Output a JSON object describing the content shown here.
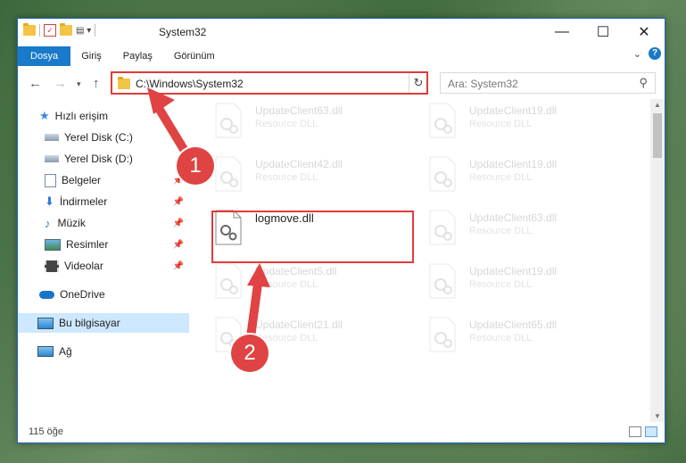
{
  "window": {
    "title": "System32",
    "controls": {
      "minimize": "—",
      "maximize": "☐",
      "close": "✕"
    }
  },
  "ribbon": {
    "tabs": [
      "Dosya",
      "Giriş",
      "Paylaş",
      "Görünüm"
    ],
    "help": "?"
  },
  "address_bar": {
    "path": "C:\\Windows\\System32",
    "refresh": "↻",
    "search_placeholder": "Ara: System32"
  },
  "navigation": {
    "items": [
      {
        "label": "Hızlı erişim",
        "icon": "star-icon"
      },
      {
        "label": "Yerel Disk (C:)",
        "icon": "drive-icon"
      },
      {
        "label": "Yerel Disk (D:)",
        "icon": "drive-icon"
      },
      {
        "label": "Belgeler",
        "icon": "documents-icon"
      },
      {
        "label": "İndirmeler",
        "icon": "download-icon"
      },
      {
        "label": "Müzik",
        "icon": "music-icon"
      },
      {
        "label": "Resimler",
        "icon": "pictures-icon"
      },
      {
        "label": "Videolar",
        "icon": "videos-icon"
      },
      {
        "label": "OneDrive",
        "icon": "cloud-icon"
      },
      {
        "label": "Bu bilgisayar",
        "icon": "computer-icon"
      },
      {
        "label": "Ağ",
        "icon": "network-icon"
      }
    ]
  },
  "files": [
    {
      "name": "UpdateClient63.dll",
      "type": "Resource DLL"
    },
    {
      "name": "UpdateClient19.dll",
      "type": "Resource DLL"
    },
    {
      "name": "UpdateClient42.dll",
      "type": "Resource DLL"
    },
    {
      "name": "UpdateClient19.dll",
      "type": "Resource DLL"
    },
    {
      "name": "logmove.dll",
      "type": ""
    },
    {
      "name": "UpdateClient63.dll",
      "type": "Resource DLL"
    },
    {
      "name": "UpdateClient5.dll",
      "type": "Resource DLL"
    },
    {
      "name": "UpdateClient19.dll",
      "type": "Resource DLL"
    },
    {
      "name": "UpdateClient21.dll",
      "type": "Resource DLL"
    },
    {
      "name": "UpdateClient65.dll",
      "type": "Resource DLL"
    }
  ],
  "status": {
    "item_count": "115 öğe"
  },
  "annotations": {
    "step1": "1",
    "step2": "2",
    "color": "#e04343"
  }
}
